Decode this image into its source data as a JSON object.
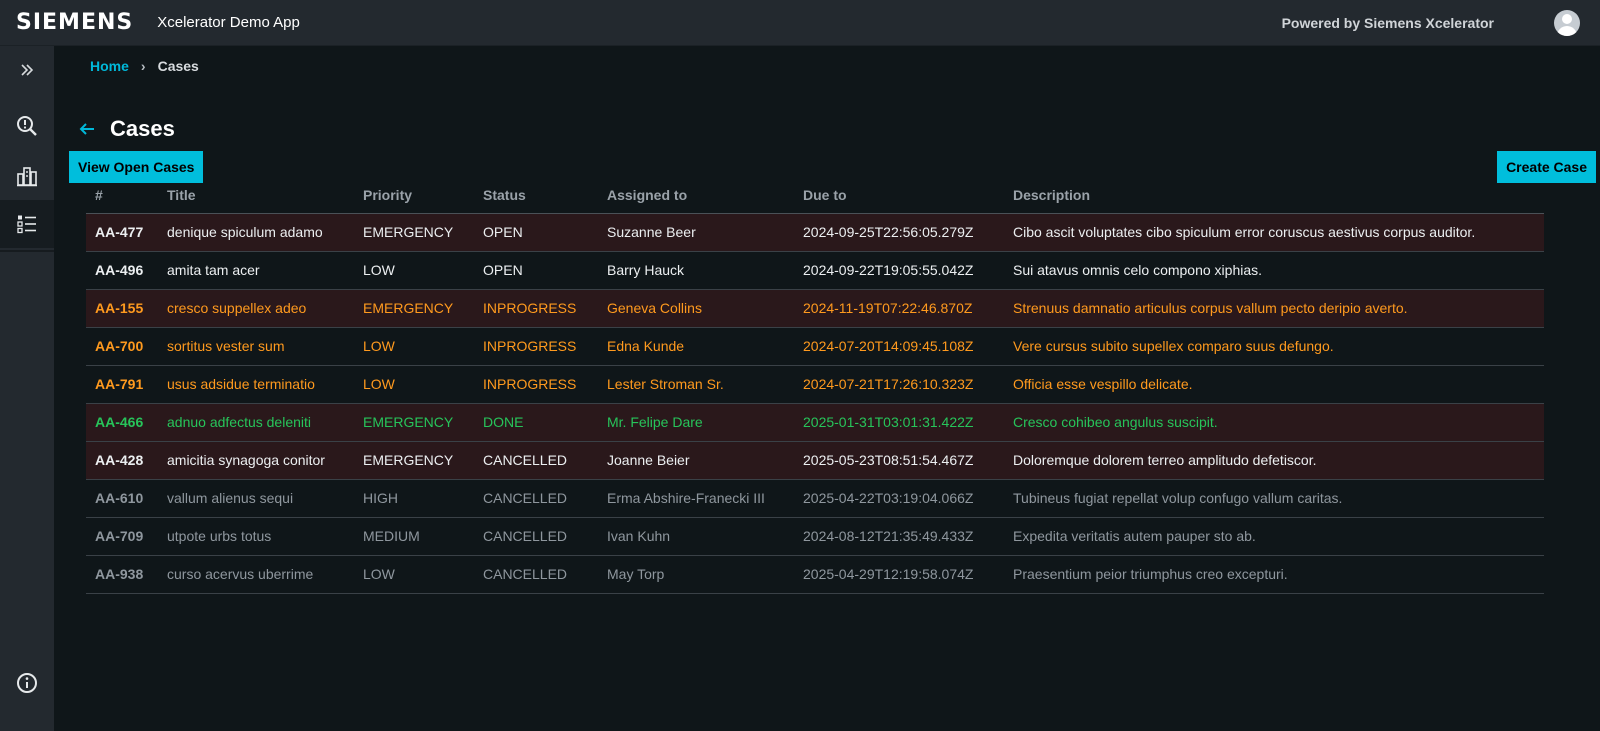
{
  "header": {
    "logo": "SIEMENS",
    "app_name": "Xcelerator Demo App",
    "powered_by": "Powered by Siemens Xcelerator",
    "avatar_icon": "user-avatar-icon"
  },
  "sidebar": {
    "items": [
      {
        "name": "expand",
        "icon": "double-chevron-right-icon"
      },
      {
        "name": "search-alerts",
        "icon": "search-alert-icon"
      },
      {
        "name": "buildings",
        "icon": "building-icon"
      },
      {
        "name": "cases-list",
        "icon": "list-icon"
      },
      {
        "name": "info",
        "icon": "info-icon"
      }
    ]
  },
  "breadcrumb": {
    "home": "Home",
    "separator": "›",
    "current": "Cases"
  },
  "page": {
    "title": "Cases",
    "view_open_label": "View Open Cases",
    "create_label": "Create Case"
  },
  "colors": {
    "accent": "#00bedc",
    "emergency_row_bg": "#2a181b",
    "inprogress": "#ff9a1e",
    "done": "#27c45a",
    "cancelled_muted": "#8f979e"
  },
  "table": {
    "columns": [
      "#",
      "Title",
      "Priority",
      "Status",
      "Assigned to",
      "Due to",
      "Description"
    ],
    "rows": [
      {
        "id": "AA-477",
        "title": "denique spiculum adamo",
        "priority": "EMERGENCY",
        "status": "OPEN",
        "assigned": "Suzanne Beer",
        "due": "2024-09-25T22:56:05.279Z",
        "description": "Cibo ascit voluptates cibo spiculum error coruscus aestivus corpus auditor.",
        "tone": "white",
        "emergency": true
      },
      {
        "id": "AA-496",
        "title": "amita tam acer",
        "priority": "LOW",
        "status": "OPEN",
        "assigned": "Barry Hauck",
        "due": "2024-09-22T19:05:55.042Z",
        "description": "Sui atavus omnis celo compono xiphias.",
        "tone": "white",
        "emergency": false
      },
      {
        "id": "AA-155",
        "title": "cresco suppellex adeo",
        "priority": "EMERGENCY",
        "status": "INPROGRESS",
        "assigned": "Geneva Collins",
        "due": "2024-11-19T07:22:46.870Z",
        "description": "Strenuus damnatio articulus corpus vallum pecto deripio averto.",
        "tone": "orange",
        "emergency": true
      },
      {
        "id": "AA-700",
        "title": "sortitus vester sum",
        "priority": "LOW",
        "status": "INPROGRESS",
        "assigned": "Edna Kunde",
        "due": "2024-07-20T14:09:45.108Z",
        "description": "Vere cursus subito supellex comparo suus defungo.",
        "tone": "orange",
        "emergency": false
      },
      {
        "id": "AA-791",
        "title": "usus adsidue terminatio",
        "priority": "LOW",
        "status": "INPROGRESS",
        "assigned": "Lester Stroman Sr.",
        "due": "2024-07-21T17:26:10.323Z",
        "description": "Officia esse vespillo delicate.",
        "tone": "orange",
        "emergency": false
      },
      {
        "id": "AA-466",
        "title": "adnuo adfectus deleniti",
        "priority": "EMERGENCY",
        "status": "DONE",
        "assigned": "Mr. Felipe Dare",
        "due": "2025-01-31T03:01:31.422Z",
        "description": "Cresco cohibeo angulus suscipit.",
        "tone": "green",
        "emergency": true
      },
      {
        "id": "AA-428",
        "title": "amicitia synagoga conitor",
        "priority": "EMERGENCY",
        "status": "CANCELLED",
        "assigned": "Joanne Beier",
        "due": "2025-05-23T08:51:54.467Z",
        "description": "Doloremque dolorem terreo amplitudo defetiscor.",
        "tone": "white",
        "emergency": true
      },
      {
        "id": "AA-610",
        "title": "vallum alienus sequi",
        "priority": "HIGH",
        "status": "CANCELLED",
        "assigned": "Erma Abshire-Franecki III",
        "due": "2025-04-22T03:19:04.066Z",
        "description": "Tubineus fugiat repellat volup confugo vallum caritas.",
        "tone": "grey",
        "emergency": false
      },
      {
        "id": "AA-709",
        "title": "utpote urbs totus",
        "priority": "MEDIUM",
        "status": "CANCELLED",
        "assigned": "Ivan Kuhn",
        "due": "2024-08-12T21:35:49.433Z",
        "description": "Expedita veritatis autem pauper sto ab.",
        "tone": "grey",
        "emergency": false
      },
      {
        "id": "AA-938",
        "title": "curso acervus uberrime",
        "priority": "LOW",
        "status": "CANCELLED",
        "assigned": "May Torp",
        "due": "2025-04-29T12:19:58.074Z",
        "description": "Praesentium peior triumphus creo excepturi.",
        "tone": "grey",
        "emergency": false
      }
    ]
  }
}
